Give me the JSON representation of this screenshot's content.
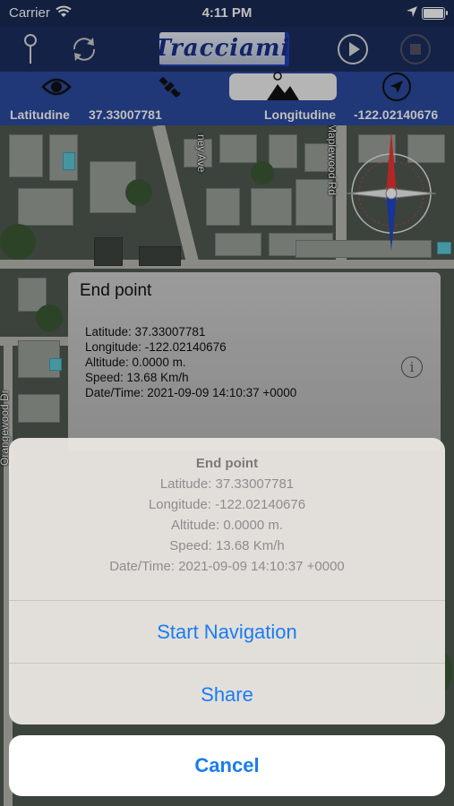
{
  "status_bar": {
    "carrier": "Carrier",
    "time": "4:11 PM"
  },
  "toolbar": {
    "logo_text": "Tracciami",
    "icons": [
      "pin-icon",
      "refresh-icon",
      "play-icon",
      "stop-icon"
    ]
  },
  "segments": {
    "items": [
      "eye-icon",
      "satellite-icon",
      "terrain-icon",
      "navigation-arrow-icon"
    ],
    "selected_index": 2
  },
  "coords": {
    "lat_label": "Latitudine",
    "lat_value": "37.33007781",
    "lon_label": "Longitudine",
    "lon_value": "-122.02140676"
  },
  "map": {
    "street_labels": [
      "ney Ave",
      "Maplewood Rd",
      "Orangewood Dr"
    ]
  },
  "callout": {
    "title": "End point",
    "lines": [
      "Latitude: 37.33007781",
      "Longitude: -122.02140676",
      "Altitude: 0.0000 m.",
      "Speed: 13.68 Km/h",
      "Date/Time: 2021-09-09 14:10:37 +0000"
    ]
  },
  "action_sheet": {
    "title": "End point",
    "lines": [
      "Latitude: 37.33007781",
      "Longitude: -122.02140676",
      "Altitude: 0.0000 m.",
      "Speed: 13.68 Km/h",
      "Date/Time: 2021-09-09 14:10:37 +0000"
    ],
    "actions": [
      "Start Navigation",
      "Share"
    ],
    "cancel": "Cancel"
  },
  "colors": {
    "toolbar": "#1b2e5f",
    "segbar": "#2b4aa0",
    "action_blue": "#1a7cf0"
  }
}
